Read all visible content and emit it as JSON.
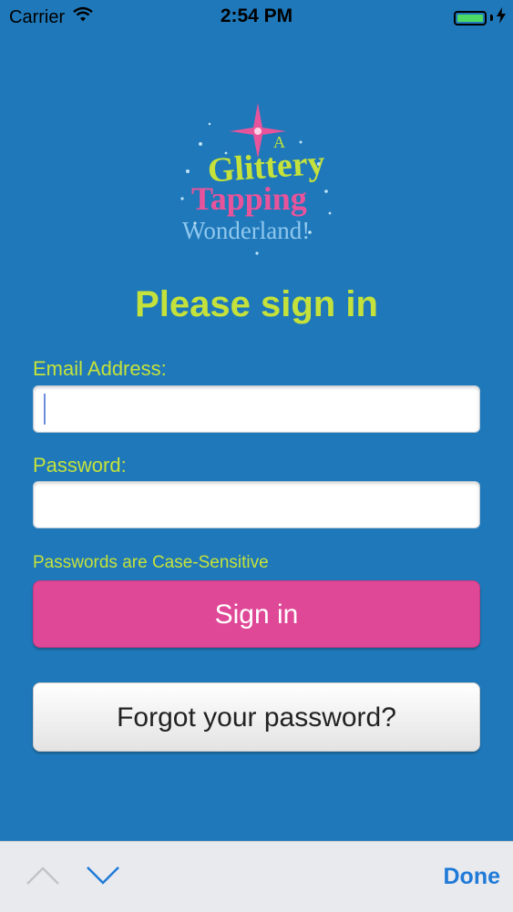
{
  "status_bar": {
    "carrier": "Carrier",
    "time": "2:54 PM",
    "battery_level": 1.0,
    "charging": true
  },
  "logo": {
    "line1": "A",
    "line2": "Glittery",
    "line3": "Tapping",
    "line4": "Wonderland!"
  },
  "form": {
    "title": "Please sign in",
    "email_label": "Email Address:",
    "email_value": "",
    "password_label": "Password:",
    "password_value": "",
    "case_hint": "Passwords are Case-Sensitive",
    "sign_in_label": "Sign in",
    "forgot_label": "Forgot your password?"
  },
  "keyboard_toolbar": {
    "prev_enabled": false,
    "next_enabled": true,
    "done_label": "Done"
  },
  "colors": {
    "background": "#1f78b9",
    "accent_green": "#c4e23b",
    "sign_in_pink": "#df4897",
    "done_blue": "#1f7ad8"
  }
}
